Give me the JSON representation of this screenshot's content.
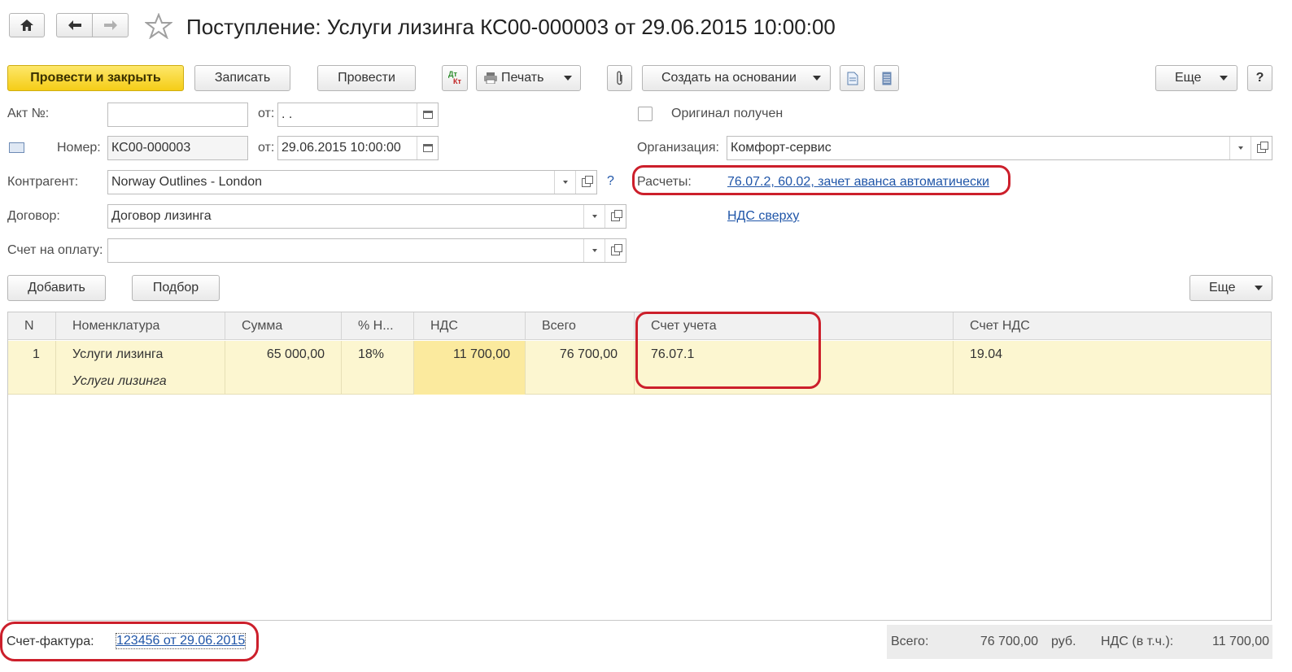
{
  "title": "Поступление: Услуги лизинга КС00-000003 от 29.06.2015 10:00:00",
  "toolbar": {
    "post_close": "Провести и закрыть",
    "save": "Записать",
    "post": "Провести",
    "dt_kt_top": "Дт",
    "dt_kt_bottom": "Кт",
    "print": "Печать",
    "create_based": "Создать на основании",
    "more": "Еще",
    "help": "?"
  },
  "form": {
    "act_label": "Акт №:",
    "act_value": "",
    "from_label": "от:",
    "act_date": " .  .",
    "number_label": "Номер:",
    "number_value": "КС00-000003",
    "date_value": "29.06.2015 10:00:00",
    "contractor_label": "Контрагент:",
    "contractor_value": "Norway Outlines - London",
    "contractor_help": "?",
    "contract_label": "Договор:",
    "contract_value": "Договор лизинга",
    "invoice_label": "Счет на оплату:",
    "invoice_value": "",
    "original_label": "Оригинал получен",
    "org_label": "Организация:",
    "org_value": "Комфорт-сервис",
    "settlements_label": "Расчеты:",
    "settlements_link": "76.07.2, 60.02, зачет аванса автоматически",
    "vat_link": "НДС сверху"
  },
  "table_toolbar": {
    "add": "Добавить",
    "pick": "Подбор",
    "more": "Еще"
  },
  "table": {
    "headers": [
      "N",
      "Номенклатура",
      "Сумма",
      "% Н...",
      "НДС",
      "Всего",
      "Счет учета",
      "Счет НДС"
    ],
    "rows": [
      {
        "n": "1",
        "item": "Услуги лизинга",
        "item_desc": "Услуги лизинга",
        "sum": "65 000,00",
        "rate": "18%",
        "vat": "11 700,00",
        "total": "76 700,00",
        "account": "76.07.1",
        "vat_account": "19.04"
      }
    ]
  },
  "footer": {
    "invoice_label": "Счет-фактура:",
    "invoice_link": "123456 от 29.06.2015",
    "total_label": "Всего:",
    "total_value": "76 700,00",
    "currency": "руб.",
    "vat_label": "НДС (в т.ч.):",
    "vat_value": "11 700,00"
  },
  "colors": {
    "accent_yellow": "#f5cd17",
    "row_highlight": "#fcf6d0",
    "link": "#1f55a8",
    "annotation_red": "#cc1f2b"
  }
}
